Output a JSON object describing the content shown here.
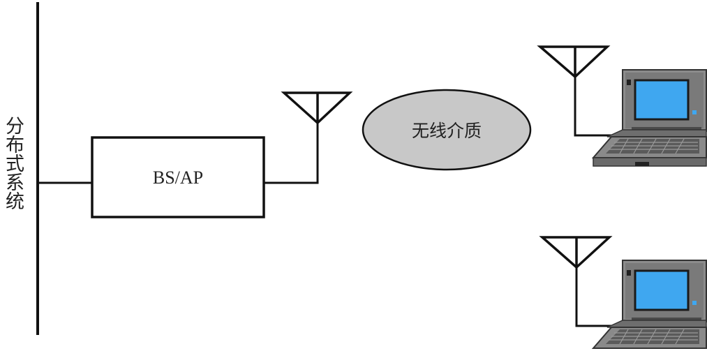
{
  "diagram": {
    "system_label": "分布式系统",
    "box_label": "BS/AP",
    "medium_label": "无线介质"
  },
  "colors": {
    "line": "#111111",
    "medium_fill": "#c8c8c8",
    "laptop_body": "#8c8c8c",
    "laptop_dark": "#5a5a5a",
    "screen": "#3fa7f0"
  },
  "icons": [
    "antenna-icon",
    "laptop-icon"
  ]
}
